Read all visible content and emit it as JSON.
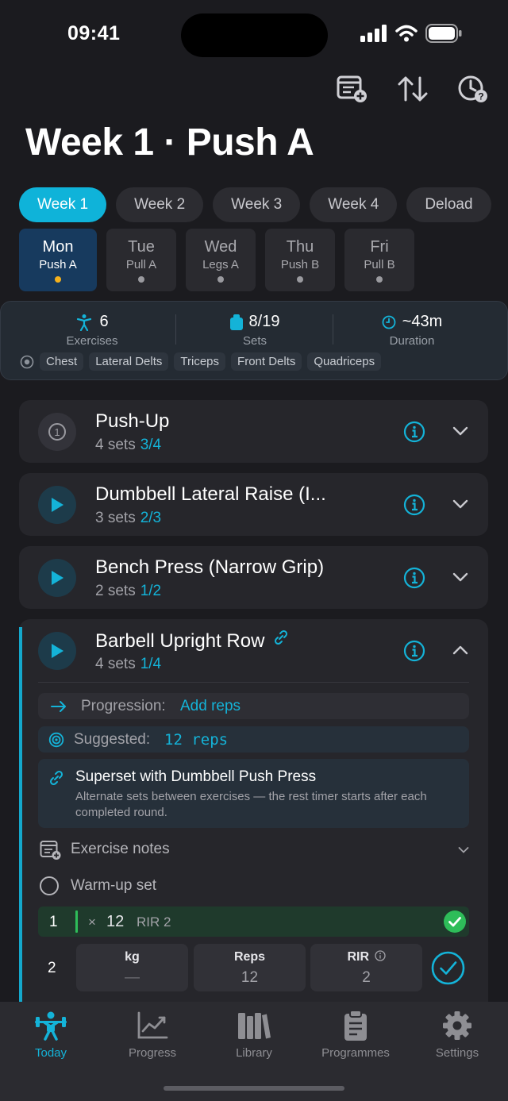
{
  "status": {
    "time": "09:41"
  },
  "header": {
    "title": "Week 1 · Push A"
  },
  "weeks": [
    "Week 1",
    "Week 2",
    "Week 3",
    "Week 4",
    "Deload"
  ],
  "days": [
    {
      "day": "Mon",
      "workout": "Push A"
    },
    {
      "day": "Tue",
      "workout": "Pull A"
    },
    {
      "day": "Wed",
      "workout": "Legs A"
    },
    {
      "day": "Thu",
      "workout": "Push B"
    },
    {
      "day": "Fri",
      "workout": "Pull B"
    }
  ],
  "summary": {
    "exercises_value": "6",
    "exercises_label": "Exercises",
    "sets_value": "8/19",
    "sets_label": "Sets",
    "duration_value": "~43m",
    "duration_label": "Duration",
    "muscles": [
      "Chest",
      "Lateral Delts",
      "Triceps",
      "Front Delts",
      "Quadriceps"
    ]
  },
  "exercises": [
    {
      "name": "Push-Up",
      "sets": "4 sets",
      "progress": "3/4",
      "badge": "1"
    },
    {
      "name": "Dumbbell Lateral Raise (I...",
      "sets": "3 sets",
      "progress": "2/3"
    },
    {
      "name": "Bench Press (Narrow Grip)",
      "sets": "2 sets",
      "progress": "1/2"
    },
    {
      "name": "Barbell Upright Row",
      "sets": "4 sets",
      "progress": "1/4"
    }
  ],
  "detail": {
    "progression_label": "Progression:",
    "progression_value": "Add reps",
    "suggested_label": "Suggested:",
    "suggested_value": "12 reps",
    "superset_title": "Superset with Dumbbell Push Press",
    "superset_desc": "Alternate sets between exercises — the rest timer starts after each completed round.",
    "notes_label": "Exercise notes",
    "warmup_label": "Warm-up set",
    "set1": {
      "num": "1",
      "x": "×",
      "reps": "12",
      "rir": "RIR 2"
    },
    "set2": {
      "num": "2",
      "kg_label": "kg",
      "kg_value": "—",
      "reps_label": "Reps",
      "reps_value": "12",
      "rir_label": "RIR",
      "rir_value": "2"
    }
  },
  "tabs": [
    "Today",
    "Progress",
    "Library",
    "Programmes",
    "Settings"
  ],
  "colors": {
    "accent": "#14b3d8",
    "done": "#2ebd59",
    "dot": "#f5b11c"
  }
}
